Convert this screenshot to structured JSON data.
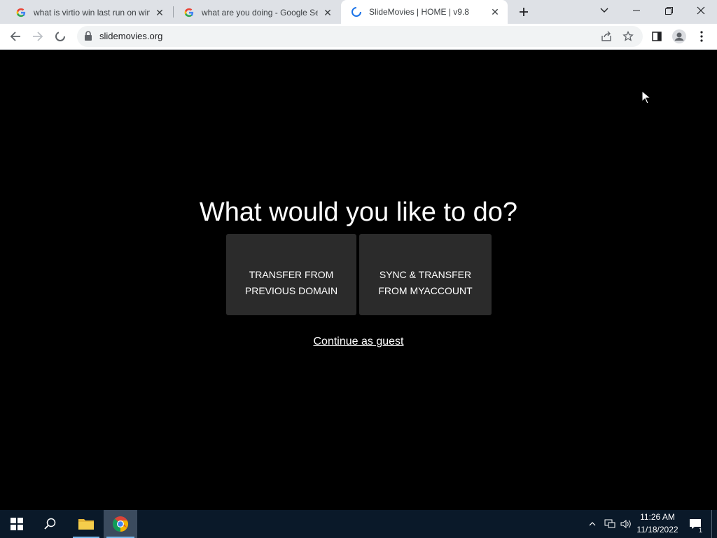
{
  "browser": {
    "tabs": [
      {
        "title": "what is virtio win last run on windows",
        "favicon": "google-icon"
      },
      {
        "title": "what are you doing - Google Search",
        "favicon": "google-icon"
      },
      {
        "title": "SlideMovies | HOME | v9.8",
        "favicon": "loading-spinner-icon"
      }
    ],
    "url": "slidemovies.org"
  },
  "page": {
    "heading": "What would you like to do?",
    "option1": {
      "line1": "TRANSFER FROM",
      "line2": "PREVIOUS DOMAIN"
    },
    "option2": {
      "line1": "SYNC & TRANSFER",
      "line2": "FROM MYACCOUNT"
    },
    "guest_link": "Continue as guest"
  },
  "taskbar": {
    "time": "11:26 AM",
    "date": "11/18/2022",
    "notification_count": "1"
  },
  "colors": {
    "page_bg": "#000000",
    "card_bg": "#2b2b2b",
    "taskbar_bg": "#0a1929"
  }
}
